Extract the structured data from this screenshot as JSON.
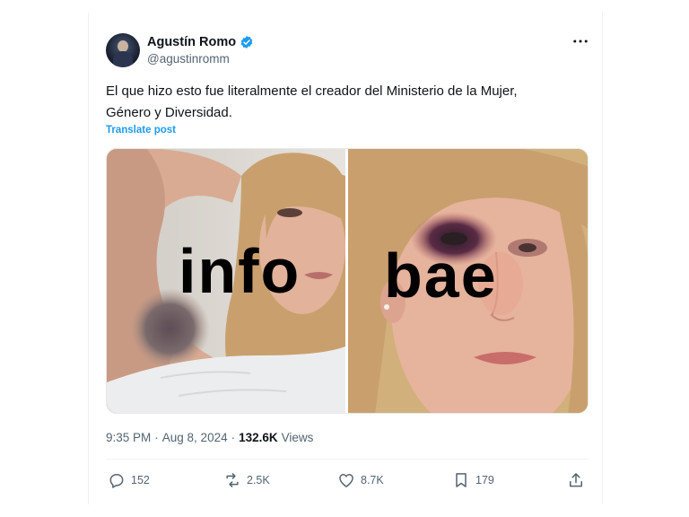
{
  "author": {
    "display_name": "Agustín Romo",
    "handle": "@agustinromm",
    "verified": true
  },
  "tweet": {
    "text_line1": "El que hizo esto fue literalmente el creador del Ministerio de la Mujer,",
    "text_line2": "Género y Diversidad.",
    "translate_label": "Translate post"
  },
  "media": {
    "watermark_left": "info",
    "watermark_right": "bae"
  },
  "meta": {
    "time": "9:35 PM",
    "separator1": "·",
    "date": "Aug 8, 2024",
    "separator2": "·",
    "views_count": "132.6K",
    "views_label": "Views"
  },
  "actions": {
    "reply_count": "152",
    "repost_count": "2.5K",
    "like_count": "8.7K",
    "bookmark_count": "179"
  },
  "colors": {
    "accent": "#1d9bf0",
    "text": "#0f1419",
    "secondary": "#536471"
  },
  "icons": [
    "verified-badge-icon",
    "more-icon",
    "reply-icon",
    "repost-icon",
    "like-icon",
    "bookmark-icon",
    "share-icon"
  ]
}
